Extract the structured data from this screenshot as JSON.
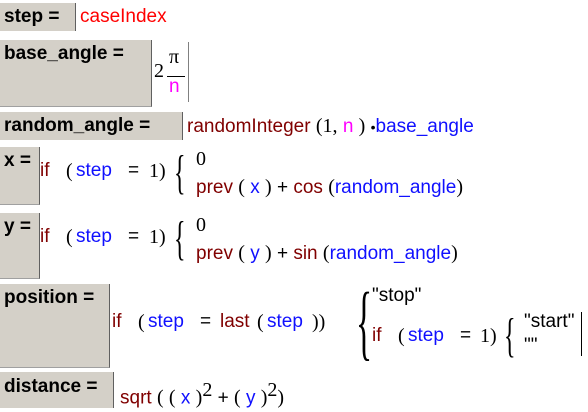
{
  "rows": {
    "step": {
      "label": "step =",
      "value": "caseIndex"
    },
    "base_angle": {
      "label": "base_angle =",
      "coef": "2",
      "num": "π",
      "den": "n"
    },
    "random_angle": {
      "label": "random_angle =",
      "func": "randomInteger",
      "lp": "(",
      "arg1": "1,",
      "arg2": "n",
      "rp": ")",
      "dot": "•",
      "mult": "base_angle"
    },
    "x": {
      "label": "x =",
      "if": "if",
      "lp": "(",
      "cond": "step",
      "eq": "=",
      "one": "1)",
      "case1": "0",
      "prev": "prev",
      "plp": "(",
      "var": "x",
      "prp": ")",
      "plus": "+",
      "trig": "cos",
      "tlp": "(",
      "targ": "random_angle",
      "trp": ")"
    },
    "y": {
      "label": "y =",
      "if": "if",
      "lp": "(",
      "cond": "step",
      "eq": "=",
      "one": "1)",
      "case1": "0",
      "prev": "prev",
      "plp": "(",
      "var": "y",
      "prp": ")",
      "plus": "+",
      "trig": "sin",
      "tlp": "(",
      "targ": "random_angle",
      "trp": ")"
    },
    "position": {
      "label": "position =",
      "if": "if",
      "lp": "(",
      "cond": "step",
      "eq": "=",
      "last": "last",
      "llp": "(",
      "larg": "step",
      "lrp": "))",
      "case1": "\"stop\"",
      "if2": "if",
      "lp2": "(",
      "cond2": "step",
      "eq2": "=",
      "one2": "1)",
      "start": "\"start\"",
      "empty": "\"\""
    },
    "distance": {
      "label": "distance =",
      "func": "sqrt",
      "lp": "(",
      "lp2": "(",
      "x": "x",
      "rp1": ")",
      "exp1": "2",
      "plus": "+",
      "lp3": "(",
      "y": "y",
      "rp2": ")",
      "exp2": "2",
      "rp3": ")"
    }
  }
}
